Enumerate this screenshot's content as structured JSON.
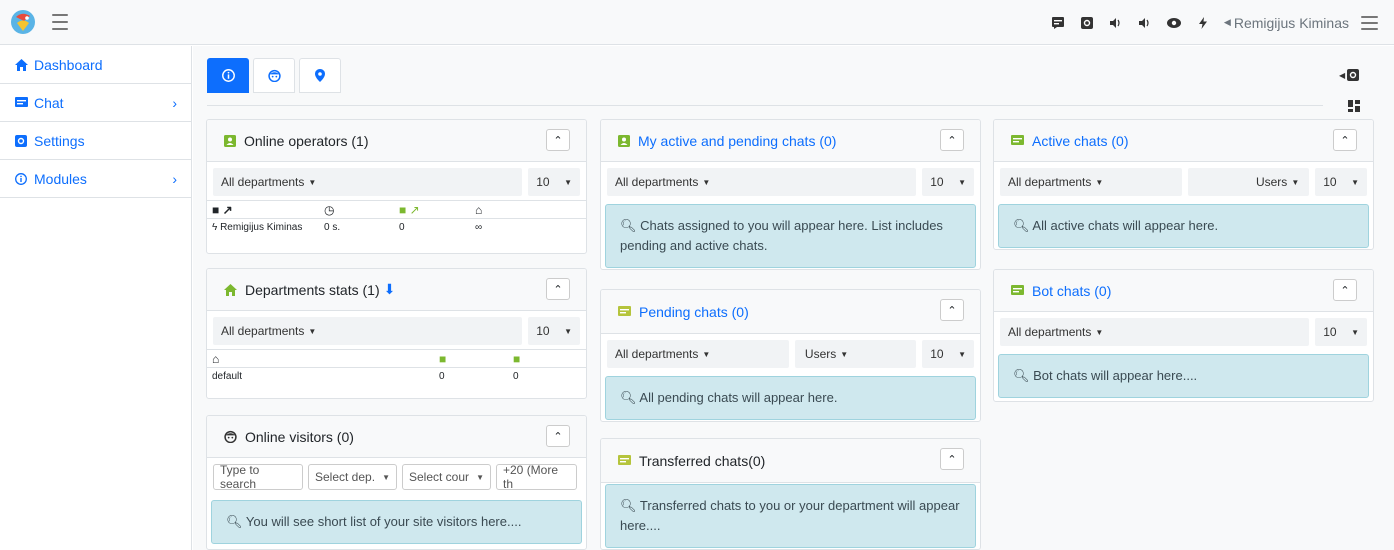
{
  "header": {
    "user_name": "Remigijus Kiminas",
    "icons": [
      "message-icon",
      "settings-icon",
      "sound-icon",
      "sound-icon",
      "eye-icon",
      "bolt-icon"
    ]
  },
  "sidebar": {
    "items": [
      {
        "label": "Dashboard",
        "icon": "home-icon"
      },
      {
        "label": "Chat",
        "icon": "chat-icon"
      },
      {
        "label": "Settings",
        "icon": "settings-icon"
      },
      {
        "label": "Modules",
        "icon": "info-icon"
      }
    ]
  },
  "online_operators": {
    "title": "Online operators (1)",
    "dept": "All departments",
    "per_page": "10",
    "row": {
      "name": "Remigijus Kiminas",
      "time": "0 s.",
      "chats": "0",
      "max": "∞"
    }
  },
  "departments_stats": {
    "title": "Departments stats (1)",
    "dept": "All departments",
    "per_page": "10",
    "row": {
      "name": "default",
      "a": "0",
      "b": "0"
    }
  },
  "online_visitors": {
    "title": "Online visitors (0)",
    "search_placeholder": "Type to search",
    "select_dep": "Select dep.",
    "select_country": "Select cour",
    "more": "+20 (More th",
    "info": "You will see short list of your site visitors here...."
  },
  "my_active": {
    "title": "My active and pending chats (0)",
    "dept": "All departments",
    "per_page": "10",
    "info": "Chats assigned to you will appear here. List includes pending and active chats."
  },
  "pending": {
    "title": "Pending chats (0)",
    "dept": "All departments",
    "users": "Users",
    "per_page": "10",
    "info": "All pending chats will appear here."
  },
  "transferred": {
    "title": "Transferred chats(0)",
    "info": "Transferred chats to you or your department will appear here...."
  },
  "active_chats": {
    "title": "Active chats (0)",
    "dept": "All departments",
    "users": "Users",
    "per_page": "10",
    "info": "All active chats will appear here."
  },
  "bot_chats": {
    "title": "Bot chats (0)",
    "dept": "All departments",
    "per_page": "10",
    "info": "Bot chats will appear here...."
  },
  "colors": {
    "accent": "#0d6efd",
    "green": "#7cb82f",
    "info_bg": "#cfe8ee"
  }
}
